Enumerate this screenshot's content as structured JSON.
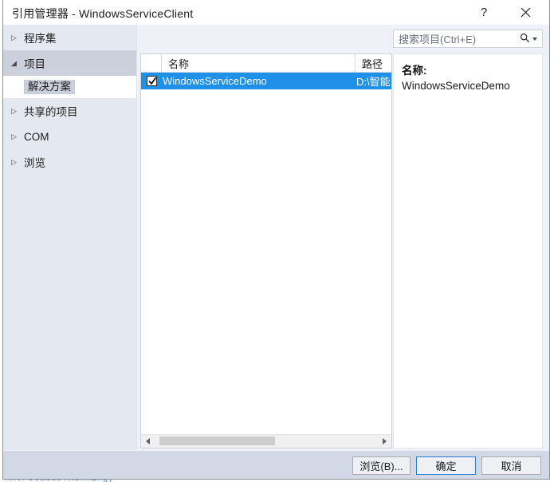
{
  "background": {
    "code_line": "nnerStatus.Running;"
  },
  "window": {
    "title": "引用管理器 - WindowsServiceClient",
    "help_label": "?",
    "close_icon": "close-icon"
  },
  "sidebar": {
    "items": [
      {
        "label": "程序集",
        "chevron": "▷",
        "expanded": false
      },
      {
        "label": "项目",
        "chevron": "◢",
        "expanded": true
      },
      {
        "label": "共享的项目",
        "chevron": "▷",
        "expanded": false
      },
      {
        "label": "COM",
        "chevron": "▷",
        "expanded": false
      },
      {
        "label": "浏览",
        "chevron": "▷",
        "expanded": false
      }
    ],
    "sub_item": {
      "label": "解决方案",
      "selected": true
    }
  },
  "search": {
    "placeholder": "搜索项目(Ctrl+E)",
    "icon": "search-icon",
    "dropdown_icon": "chevron-down-icon"
  },
  "list": {
    "columns": [
      "名称",
      "路径"
    ],
    "rows": [
      {
        "checked": true,
        "name": "WindowsServiceDemo",
        "path": "D:\\智能",
        "selected": true
      }
    ],
    "scrollbar": {
      "left_arrow": "chevron-left-icon",
      "right_arrow": "chevron-right-icon"
    }
  },
  "detail": {
    "label": "名称:",
    "value": "WindowsServiceDemo"
  },
  "buttons": {
    "browse": "浏览(B)...",
    "ok": "确定",
    "cancel": "取消"
  },
  "colors": {
    "selection_blue": "#1e90e8",
    "default_button_border": "#2a7fd4",
    "sidebar_bg": "#e4e8f1",
    "bottom_bar_bg": "#d3d8e6"
  }
}
